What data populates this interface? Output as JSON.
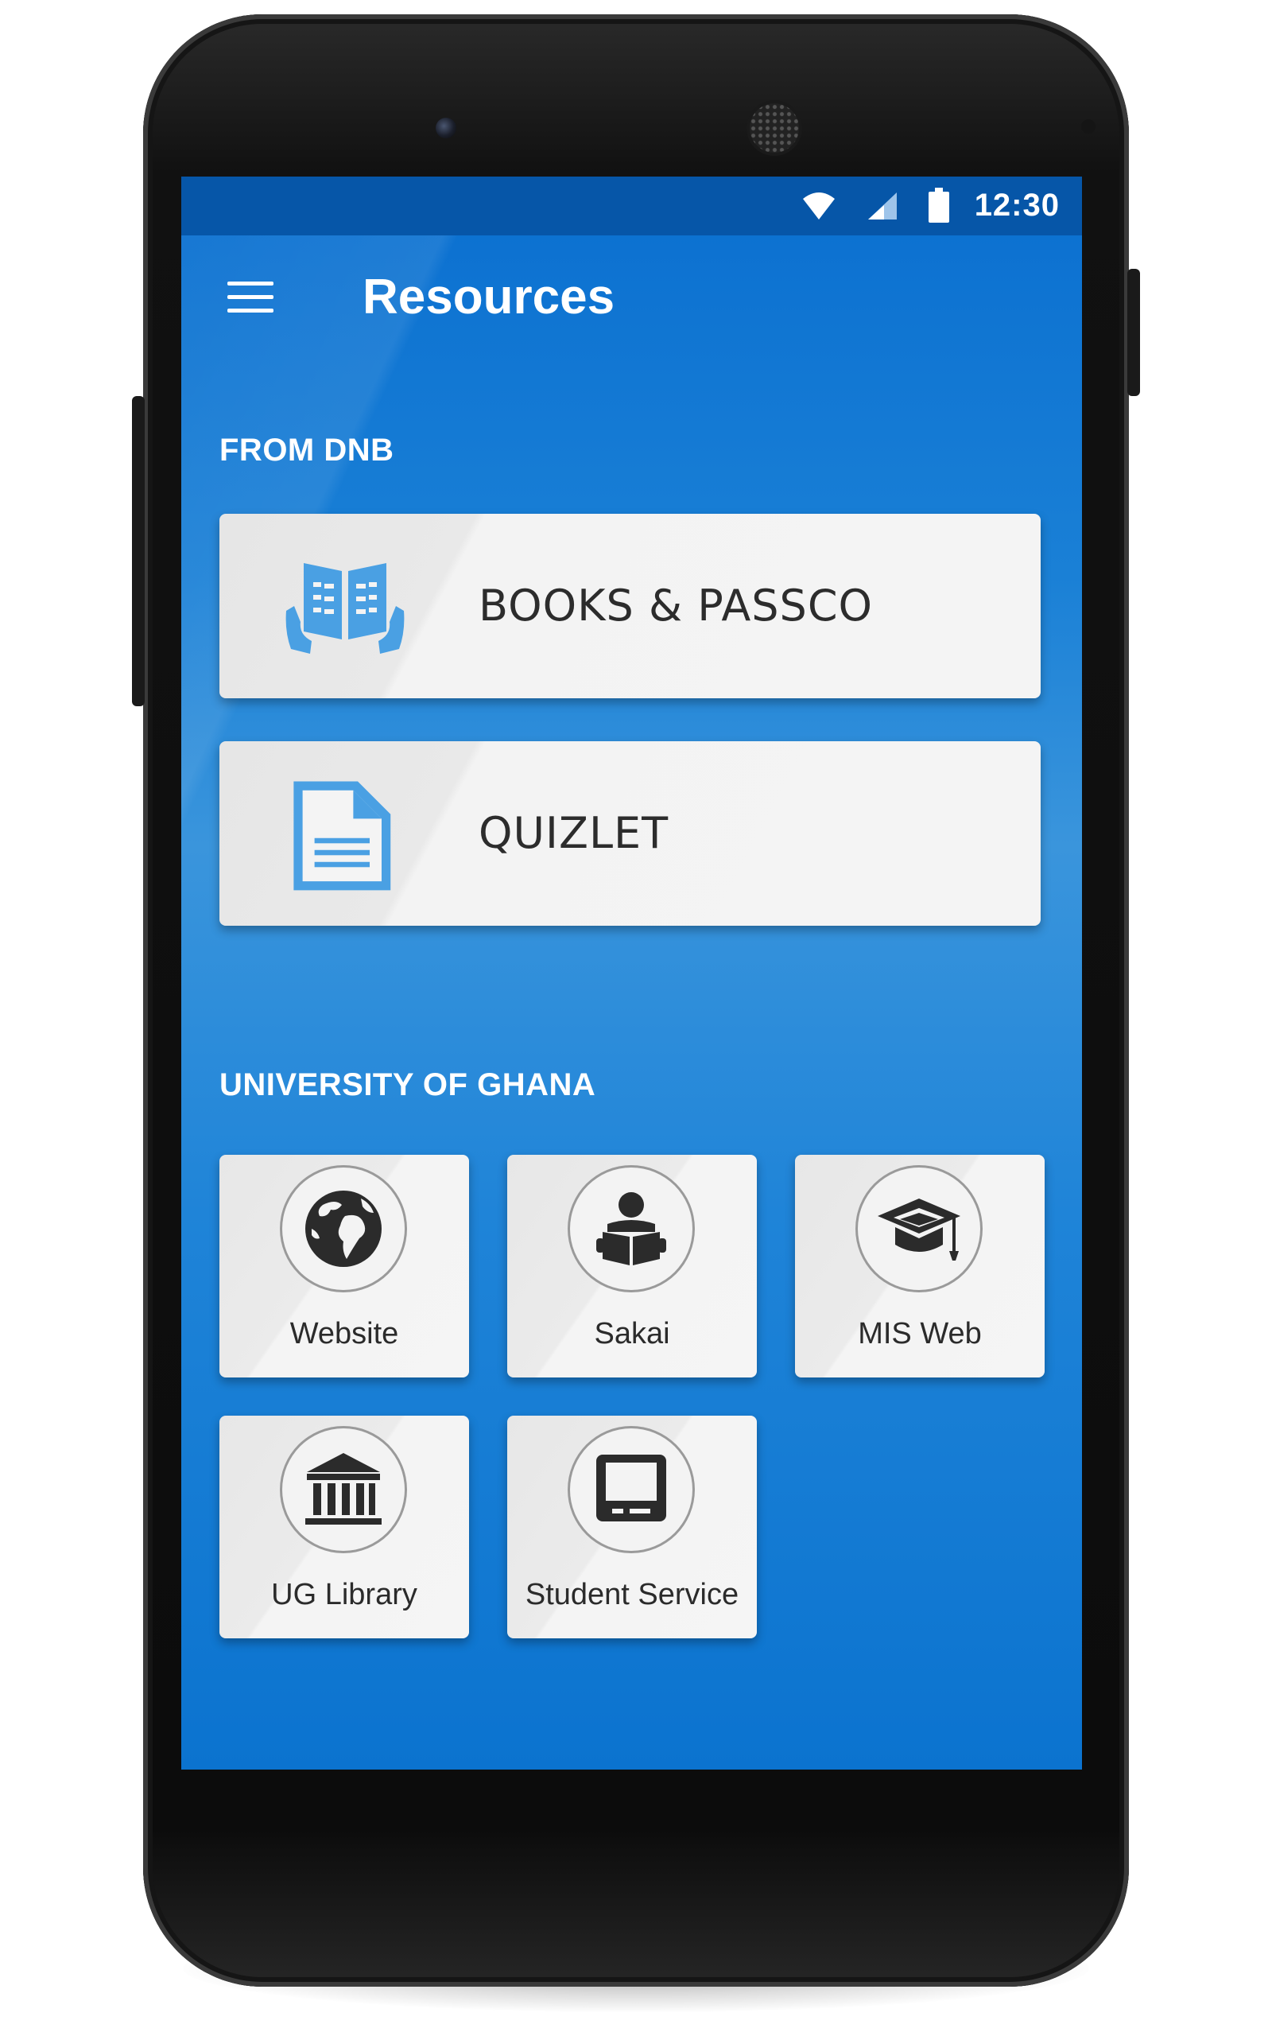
{
  "status_bar": {
    "time": "12:30",
    "icons": [
      "wifi-icon",
      "cell-signal-icon",
      "battery-icon"
    ]
  },
  "app_bar": {
    "title": "Resources",
    "menu_icon": "hamburger-menu-icon"
  },
  "sections": {
    "dnb": {
      "label": "FROM DNB",
      "items": [
        {
          "label": "BOOKS & PASSCO",
          "icon": "open-book-icon"
        },
        {
          "label": "QUIZLET",
          "icon": "document-icon"
        }
      ]
    },
    "ug": {
      "label": "UNIVERSITY OF GHANA",
      "items": [
        {
          "label": "Website",
          "icon": "globe-icon"
        },
        {
          "label": "Sakai",
          "icon": "reader-icon"
        },
        {
          "label": "MIS Web",
          "icon": "graduation-cap-icon"
        },
        {
          "label": "UG Library",
          "icon": "library-building-icon"
        },
        {
          "label": "Student Service",
          "icon": "kiosk-terminal-icon"
        }
      ]
    }
  },
  "colors": {
    "accent_blue": "#0b73cf",
    "status_bar": "#0656a8",
    "card": "#f4f4f4",
    "icon_blue": "#4aa0e3",
    "icon_dark": "#2b2b2b"
  }
}
